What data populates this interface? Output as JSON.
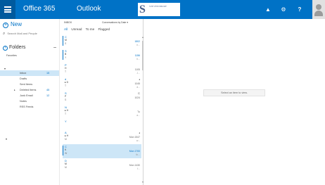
{
  "header": {
    "brand": "Office 365",
    "app": "Outlook",
    "logo_mark": "S",
    "logo_name": "STEVENSBURY",
    "logo_tag": "",
    "icons": [
      "bell-icon",
      "gear-icon",
      "help-icon"
    ],
    "help_label": "?",
    "colors": {
      "bar": "#0072c6",
      "waffle": "#005a9e"
    }
  },
  "nav": {
    "new_label": "New",
    "search_placeholder": "Search Mail and People",
    "folders_label": "Folders",
    "favorites_label": "Favorites",
    "folders": [
      {
        "label": "Inbox",
        "count": "15",
        "selected": true
      },
      {
        "label": "Drafts",
        "count": ""
      },
      {
        "label": "Sent Items",
        "count": ""
      },
      {
        "label": "Deleted Items",
        "count": "45"
      },
      {
        "label": "Junk Email",
        "count": "12"
      },
      {
        "label": "Notes",
        "count": ""
      },
      {
        "label": "RSS Feeds",
        "count": ""
      }
    ]
  },
  "list": {
    "title": "INBOX",
    "sort": "Conversations by Date",
    "filters": [
      "All",
      "Unread",
      "To me",
      "Flagged"
    ],
    "messages": [
      {
        "l1": "C",
        "l2": "M",
        "l3": "S",
        "time": "1802",
        "extra": "n..."
      },
      {
        "l1": "S",
        "l2": "B",
        "l3": "Y",
        "time": "1156",
        "extra": "h..."
      },
      {
        "l1": "P",
        "l2": "H",
        "l3": "T",
        "time": "1105",
        "extra": "J..."
      },
      {
        "l1": "d",
        "l2": "▸ D",
        "l3": "T",
        "time": "1045",
        "extra": "d..."
      },
      {
        "l1": "S",
        "l2": "P",
        "l3": "S",
        "time": "1024",
        "extra": ""
      },
      {
        "l1": "N",
        "l2": "▸ H",
        "l3": "T",
        "time": "Tu",
        "extra": "a..."
      },
      {
        "l1": "Y",
        "l2": "",
        "l3": "",
        "time": "",
        "extra": ""
      },
      {
        "l1": "A",
        "l2": "▸ H",
        "l3": "M",
        "time": "Mon 1547",
        "extra": "w..."
      },
      {
        "l1": "C",
        "l2": "K",
        "l3": "W",
        "time": "Mon 1700",
        "extra": "th..."
      },
      {
        "l1": "D",
        "l2": "M",
        "l3": "M",
        "time": "Mon 1430",
        "extra": "f..."
      }
    ]
  },
  "reading": {
    "empty_text": "Select an item to view."
  }
}
